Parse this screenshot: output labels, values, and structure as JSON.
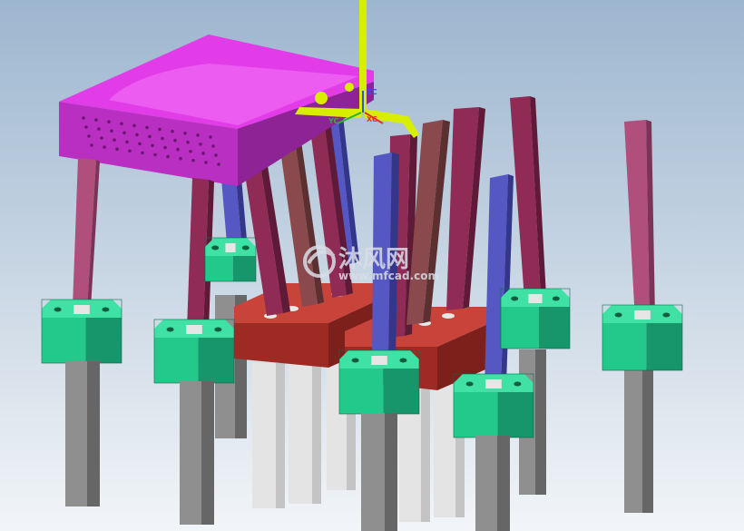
{
  "viewport": {
    "background_top": "#9db6cf",
    "background_bottom": "#f2f5f8"
  },
  "colors": {
    "housing_top": "#e23ce8",
    "housing_front": "#b92fc1",
    "housing_side": "#8d2394",
    "rod_maroon": "#8f2b55",
    "rod_maroon_dark": "#5f1a37",
    "rod_brown": "#8a4a4d",
    "rod_brown_dark": "#5c2f31",
    "rod_blue": "#5558c2",
    "rod_blue_dark": "#34368a",
    "rod_pink": "#b04f7c",
    "rod_pink_dark": "#7c3456",
    "clamp_top": "#3fe2a4",
    "clamp_front": "#22c98b",
    "clamp_side": "#16966a",
    "base_top": "#c8443a",
    "base_front": "#9e2a24",
    "post_grey_front": "#8f8f8f",
    "post_grey_side": "#666666",
    "post_white_front": "#e4e4e4",
    "post_white_side": "#c4c4c4",
    "triad_yellow": "#d8ee00",
    "axis_x": "#e03030",
    "axis_y": "#2fae3f",
    "axis_z": "#3050e0"
  },
  "triad": {
    "x_label": "XC",
    "y_label": "YC",
    "z_label": "ZC"
  },
  "watermark": {
    "title": "沐风网",
    "url": "www.mfcad.com",
    "color": "#d9dde6"
  }
}
